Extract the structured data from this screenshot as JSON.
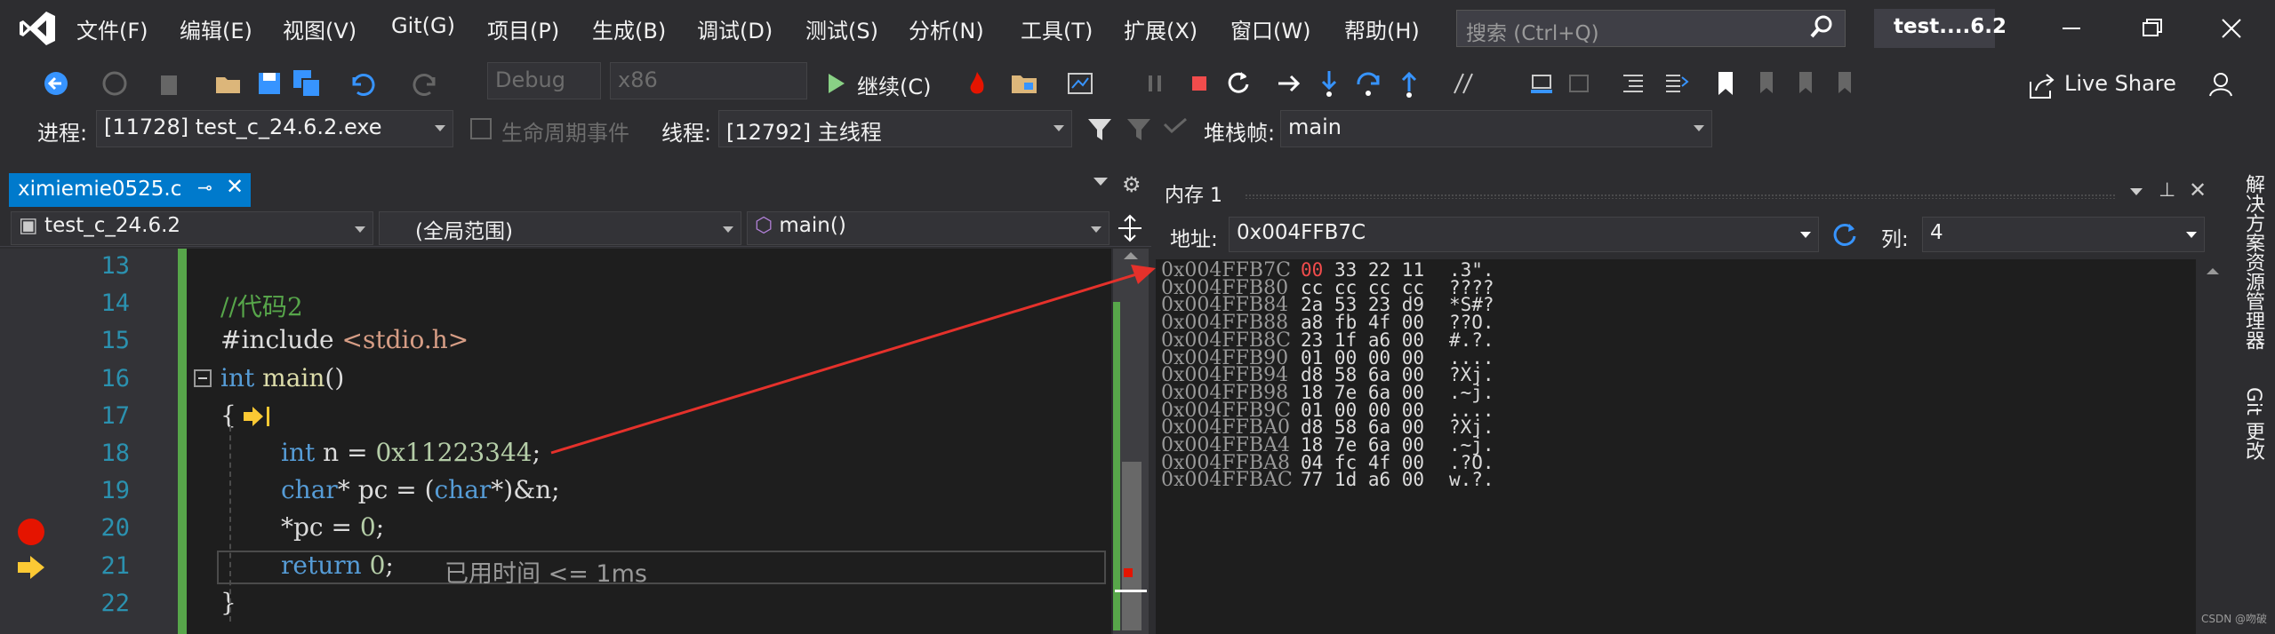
{
  "menu": [
    "文件(F)",
    "编辑(E)",
    "视图(V)",
    "Git(G)",
    "项目(P)",
    "生成(B)",
    "调试(D)",
    "测试(S)",
    "分析(N)",
    "工具(T)",
    "扩展(X)",
    "窗口(W)",
    "帮助(H)"
  ],
  "search": {
    "placeholder": "搜索 (Ctrl+Q)"
  },
  "window_title": "test....6.2",
  "toolbar": {
    "config": "Debug",
    "platform": "x86",
    "continue_label": "继续(C)",
    "live_share": "Live Share"
  },
  "debugloc": {
    "process_label": "进程:",
    "process_value": "[11728] test_c_24.6.2.exe",
    "lifecycle_label": "生命周期事件",
    "thread_label": "线程:",
    "thread_value": "[12792] 主线程",
    "stack_label": "堆栈帧:",
    "stack_value": "main"
  },
  "editor": {
    "tab_title": "ximiemie0525.c",
    "nav_project": "test_c_24.6.2",
    "nav_scope": "(全局范围)",
    "nav_function": "main()",
    "lines": [
      {
        "num": "13",
        "code": ""
      },
      {
        "num": "14",
        "code": "//代码2"
      },
      {
        "num": "15",
        "code": "#include <stdio.h>"
      },
      {
        "num": "16",
        "code": "int main()"
      },
      {
        "num": "17",
        "code": "{"
      },
      {
        "num": "18",
        "code": "int n = 0x11223344;"
      },
      {
        "num": "19",
        "code": "char* pc = (char*)&n;"
      },
      {
        "num": "20",
        "code": "*pc = 0;"
      },
      {
        "num": "21",
        "code": "return 0;"
      },
      {
        "num": "22",
        "code": "}"
      }
    ],
    "elapsed": "已用时间 <= 1ms"
  },
  "memory": {
    "title": "内存 1",
    "address_label": "地址:",
    "address_value": "0x004FFB7C",
    "columns_label": "列:",
    "columns_value": "4",
    "rows": [
      {
        "addr": "0x004FFB7C",
        "bytes": "00 33 22 11",
        "chars": ".3\"."
      },
      {
        "addr": "0x004FFB80",
        "bytes": "cc cc cc cc",
        "chars": "????"
      },
      {
        "addr": "0x004FFB84",
        "bytes": "2a 53 23 d9",
        "chars": "*S#?"
      },
      {
        "addr": "0x004FFB88",
        "bytes": "a8 fb 4f 00",
        "chars": "??O."
      },
      {
        "addr": "0x004FFB8C",
        "bytes": "23 1f a6 00",
        "chars": "#.?."
      },
      {
        "addr": "0x004FFB90",
        "bytes": "01 00 00 00",
        "chars": "...."
      },
      {
        "addr": "0x004FFB94",
        "bytes": "d8 58 6a 00",
        "chars": "?Xj."
      },
      {
        "addr": "0x004FFB98",
        "bytes": "18 7e 6a 00",
        "chars": ".~j."
      },
      {
        "addr": "0x004FFB9C",
        "bytes": "01 00 00 00",
        "chars": "...."
      },
      {
        "addr": "0x004FFBA0",
        "bytes": "d8 58 6a 00",
        "chars": "?Xj."
      },
      {
        "addr": "0x004FFBA4",
        "bytes": "18 7e 6a 00",
        "chars": ".~j."
      },
      {
        "addr": "0x004FFBA8",
        "bytes": "04 fc 4f 00",
        "chars": ".?O."
      },
      {
        "addr": "0x004FFBAC",
        "bytes": "77 1d a6 00",
        "chars": "w.?."
      }
    ]
  },
  "sidebar": [
    "解决方案资源管理器",
    "Git 更改"
  ],
  "watermark": "CSDN @吻破"
}
